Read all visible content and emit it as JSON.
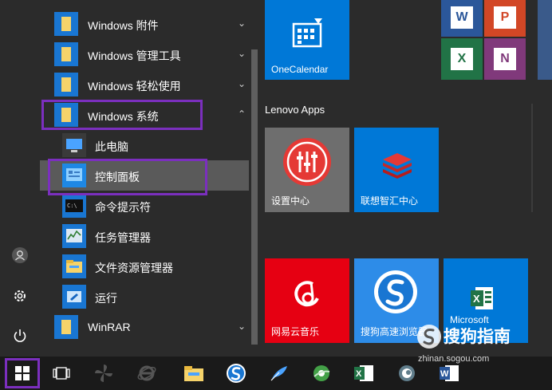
{
  "app_list": {
    "items": [
      {
        "label": "Windows 附件",
        "chevron": "⌄"
      },
      {
        "label": "Windows 管理工具",
        "chevron": "⌄"
      },
      {
        "label": "Windows 轻松使用",
        "chevron": "⌄"
      },
      {
        "label": "Windows 系统",
        "chevron": "⌃"
      },
      {
        "label": "此电脑"
      },
      {
        "label": "控制面板"
      },
      {
        "label": "命令提示符"
      },
      {
        "label": "任务管理器"
      },
      {
        "label": "文件资源管理器"
      },
      {
        "label": "运行"
      },
      {
        "label": "WinRAR",
        "chevron": "⌄"
      }
    ]
  },
  "tiles": {
    "onecalendar": "OneCalendar",
    "group": "Lenovo Apps",
    "settings_center": "设置中心",
    "lenovo_center": "联想智汇中心",
    "netease_music": "网易云音乐",
    "sogou_browser": "搜狗高速浏览器",
    "excel_label": "Microsoft"
  },
  "watermark": {
    "brand": "搜狗指南",
    "url": "zhinan.sogou.com"
  },
  "icons": {
    "start": "windows-logo-icon",
    "taskview": "task-view-icon",
    "user": "user-icon",
    "settings": "gear-icon",
    "power": "power-icon"
  }
}
